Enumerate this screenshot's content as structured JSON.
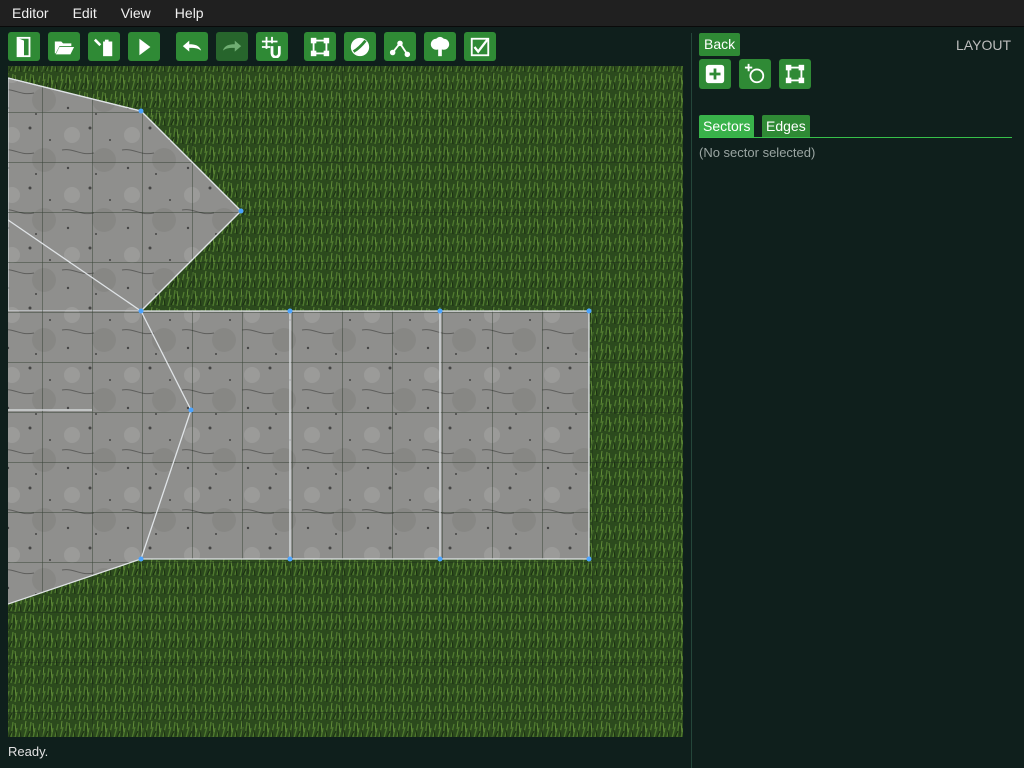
{
  "menubar": {
    "items": [
      "Editor",
      "Edit",
      "View",
      "Help"
    ]
  },
  "toolbar": {
    "buttons": [
      {
        "icon": "door-exit-icon",
        "enabled": true
      },
      {
        "icon": "folder-open-icon",
        "enabled": true
      },
      {
        "icon": "save-file-icon",
        "enabled": true
      },
      {
        "icon": "play-icon",
        "enabled": true
      },
      {
        "icon": "undo-icon",
        "enabled": true
      },
      {
        "icon": "redo-icon",
        "enabled": false
      },
      {
        "icon": "grid-magnet-icon",
        "enabled": true
      },
      {
        "icon": "layout-square-icon",
        "enabled": true
      },
      {
        "icon": "texture-ball-icon",
        "enabled": true
      },
      {
        "icon": "paths-icon",
        "enabled": true
      },
      {
        "icon": "tree-icon",
        "enabled": true
      },
      {
        "icon": "checkbox-icon",
        "enabled": true
      }
    ]
  },
  "panel": {
    "back_label": "Back",
    "title": "LAYOUT",
    "action_icons": [
      "add-sector-icon",
      "add-circle-sector-icon",
      "square-sector-icon"
    ],
    "tabs": [
      "Sectors",
      "Edges"
    ],
    "active_tab": "Sectors",
    "empty_text": "(No sector selected)"
  },
  "status": {
    "text": "Ready."
  },
  "colors": {
    "button_green": "#2f8a35",
    "tab_active": "#39b24a",
    "background": "#0f1f1c",
    "vertex_blue": "#4aa3ff",
    "stone": "#9a9a98",
    "grass": "#2f4b1f"
  }
}
